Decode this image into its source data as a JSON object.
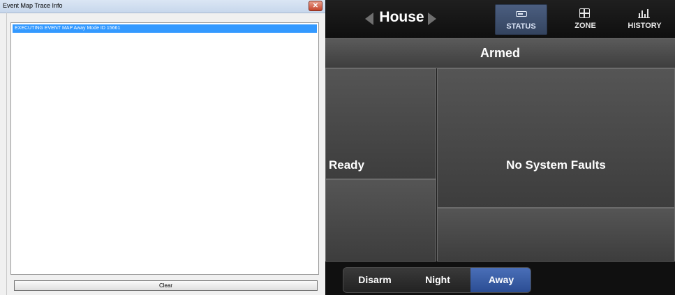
{
  "trace_window": {
    "title": "Event Map Trace Info",
    "close_glyph": "✕",
    "rows": [
      "EXECUTING EVENT MAP Away Mode ID 15661"
    ],
    "clear_label": "Clear"
  },
  "panel": {
    "location": "House",
    "tabs": [
      {
        "label": "STATUS",
        "icon": "status-icon",
        "active": true
      },
      {
        "label": "ZONE",
        "icon": "zone-icon",
        "active": false
      },
      {
        "label": "HISTORY",
        "icon": "history-icon",
        "active": false
      }
    ],
    "arm_state": "Armed",
    "ready_state": "Ready",
    "faults": "No System Faults",
    "modes": [
      {
        "label": "Disarm",
        "selected": false
      },
      {
        "label": "Night",
        "selected": false
      },
      {
        "label": "Away",
        "selected": true
      }
    ]
  },
  "colors": {
    "selection_blue": "#3399ff",
    "active_tab": "#4b5e80",
    "away_active": "#3a5ea6"
  }
}
